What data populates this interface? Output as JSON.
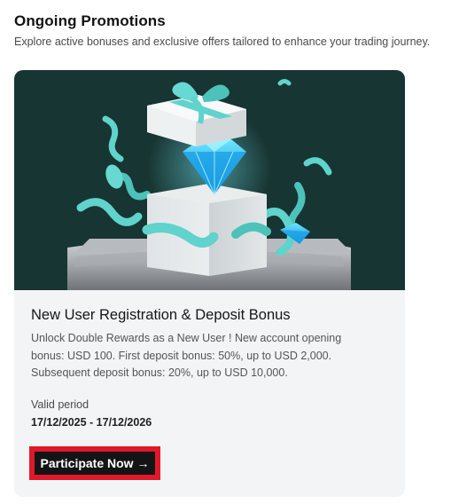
{
  "section": {
    "title": "Ongoing Promotions",
    "subtitle": "Explore active bonuses and exclusive offers tailored to enhance your trading journey."
  },
  "promotion": {
    "image_icon": "gift-box-diamond-illustration",
    "title": "New User Registration & Deposit Bonus",
    "description_lines": [
      "Unlock Double Rewards as a New User ! New account opening",
      "bonus: USD 100. First deposit bonus: 50%, up to USD 2,000.",
      "Subsequent deposit bonus: 20%, up to USD 10,000."
    ],
    "valid_label": "Valid period",
    "valid_value": "17/12/2025 - 17/12/2026",
    "cta_label": "Participate Now →"
  },
  "colors": {
    "banner_background": "#173532",
    "ribbon": "#5fd3cc",
    "diamond": "#1fb6f0",
    "cta_background": "#141414",
    "highlight_outline": "#e0192a"
  }
}
